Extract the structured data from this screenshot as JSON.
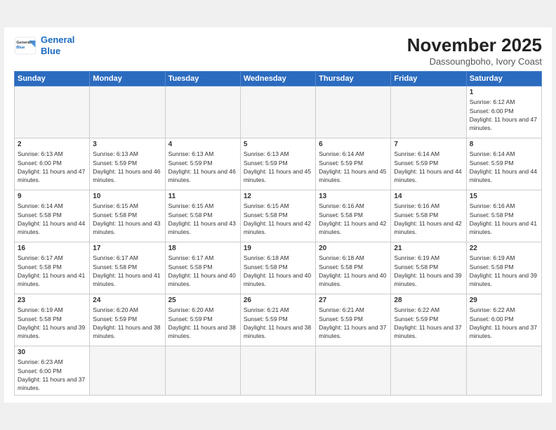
{
  "header": {
    "logo_general": "General",
    "logo_blue": "Blue",
    "month_title": "November 2025",
    "location": "Dassoungboho, Ivory Coast"
  },
  "days_of_week": [
    "Sunday",
    "Monday",
    "Tuesday",
    "Wednesday",
    "Thursday",
    "Friday",
    "Saturday"
  ],
  "weeks": [
    [
      {
        "day": "",
        "info": ""
      },
      {
        "day": "",
        "info": ""
      },
      {
        "day": "",
        "info": ""
      },
      {
        "day": "",
        "info": ""
      },
      {
        "day": "",
        "info": ""
      },
      {
        "day": "",
        "info": ""
      },
      {
        "day": "1",
        "sunrise": "6:12 AM",
        "sunset": "6:00 PM",
        "daylight": "11 hours and 47 minutes."
      }
    ],
    [
      {
        "day": "2",
        "sunrise": "6:13 AM",
        "sunset": "6:00 PM",
        "daylight": "11 hours and 47 minutes."
      },
      {
        "day": "3",
        "sunrise": "6:13 AM",
        "sunset": "5:59 PM",
        "daylight": "11 hours and 46 minutes."
      },
      {
        "day": "4",
        "sunrise": "6:13 AM",
        "sunset": "5:59 PM",
        "daylight": "11 hours and 46 minutes."
      },
      {
        "day": "5",
        "sunrise": "6:13 AM",
        "sunset": "5:59 PM",
        "daylight": "11 hours and 45 minutes."
      },
      {
        "day": "6",
        "sunrise": "6:14 AM",
        "sunset": "5:59 PM",
        "daylight": "11 hours and 45 minutes."
      },
      {
        "day": "7",
        "sunrise": "6:14 AM",
        "sunset": "5:59 PM",
        "daylight": "11 hours and 44 minutes."
      },
      {
        "day": "8",
        "sunrise": "6:14 AM",
        "sunset": "5:59 PM",
        "daylight": "11 hours and 44 minutes."
      }
    ],
    [
      {
        "day": "9",
        "sunrise": "6:14 AM",
        "sunset": "5:58 PM",
        "daylight": "11 hours and 44 minutes."
      },
      {
        "day": "10",
        "sunrise": "6:15 AM",
        "sunset": "5:58 PM",
        "daylight": "11 hours and 43 minutes."
      },
      {
        "day": "11",
        "sunrise": "6:15 AM",
        "sunset": "5:58 PM",
        "daylight": "11 hours and 43 minutes."
      },
      {
        "day": "12",
        "sunrise": "6:15 AM",
        "sunset": "5:58 PM",
        "daylight": "11 hours and 42 minutes."
      },
      {
        "day": "13",
        "sunrise": "6:16 AM",
        "sunset": "5:58 PM",
        "daylight": "11 hours and 42 minutes."
      },
      {
        "day": "14",
        "sunrise": "6:16 AM",
        "sunset": "5:58 PM",
        "daylight": "11 hours and 42 minutes."
      },
      {
        "day": "15",
        "sunrise": "6:16 AM",
        "sunset": "5:58 PM",
        "daylight": "11 hours and 41 minutes."
      }
    ],
    [
      {
        "day": "16",
        "sunrise": "6:17 AM",
        "sunset": "5:58 PM",
        "daylight": "11 hours and 41 minutes."
      },
      {
        "day": "17",
        "sunrise": "6:17 AM",
        "sunset": "5:58 PM",
        "daylight": "11 hours and 41 minutes."
      },
      {
        "day": "18",
        "sunrise": "6:17 AM",
        "sunset": "5:58 PM",
        "daylight": "11 hours and 40 minutes."
      },
      {
        "day": "19",
        "sunrise": "6:18 AM",
        "sunset": "5:58 PM",
        "daylight": "11 hours and 40 minutes."
      },
      {
        "day": "20",
        "sunrise": "6:18 AM",
        "sunset": "5:58 PM",
        "daylight": "11 hours and 40 minutes."
      },
      {
        "day": "21",
        "sunrise": "6:19 AM",
        "sunset": "5:58 PM",
        "daylight": "11 hours and 39 minutes."
      },
      {
        "day": "22",
        "sunrise": "6:19 AM",
        "sunset": "5:58 PM",
        "daylight": "11 hours and 39 minutes."
      }
    ],
    [
      {
        "day": "23",
        "sunrise": "6:19 AM",
        "sunset": "5:58 PM",
        "daylight": "11 hours and 39 minutes."
      },
      {
        "day": "24",
        "sunrise": "6:20 AM",
        "sunset": "5:59 PM",
        "daylight": "11 hours and 38 minutes."
      },
      {
        "day": "25",
        "sunrise": "6:20 AM",
        "sunset": "5:59 PM",
        "daylight": "11 hours and 38 minutes."
      },
      {
        "day": "26",
        "sunrise": "6:21 AM",
        "sunset": "5:59 PM",
        "daylight": "11 hours and 38 minutes."
      },
      {
        "day": "27",
        "sunrise": "6:21 AM",
        "sunset": "5:59 PM",
        "daylight": "11 hours and 37 minutes."
      },
      {
        "day": "28",
        "sunrise": "6:22 AM",
        "sunset": "5:59 PM",
        "daylight": "11 hours and 37 minutes."
      },
      {
        "day": "29",
        "sunrise": "6:22 AM",
        "sunset": "6:00 PM",
        "daylight": "11 hours and 37 minutes."
      }
    ],
    [
      {
        "day": "30",
        "sunrise": "6:23 AM",
        "sunset": "6:00 PM",
        "daylight": "11 hours and 37 minutes."
      },
      {
        "day": "",
        "info": ""
      },
      {
        "day": "",
        "info": ""
      },
      {
        "day": "",
        "info": ""
      },
      {
        "day": "",
        "info": ""
      },
      {
        "day": "",
        "info": ""
      },
      {
        "day": "",
        "info": ""
      }
    ]
  ]
}
